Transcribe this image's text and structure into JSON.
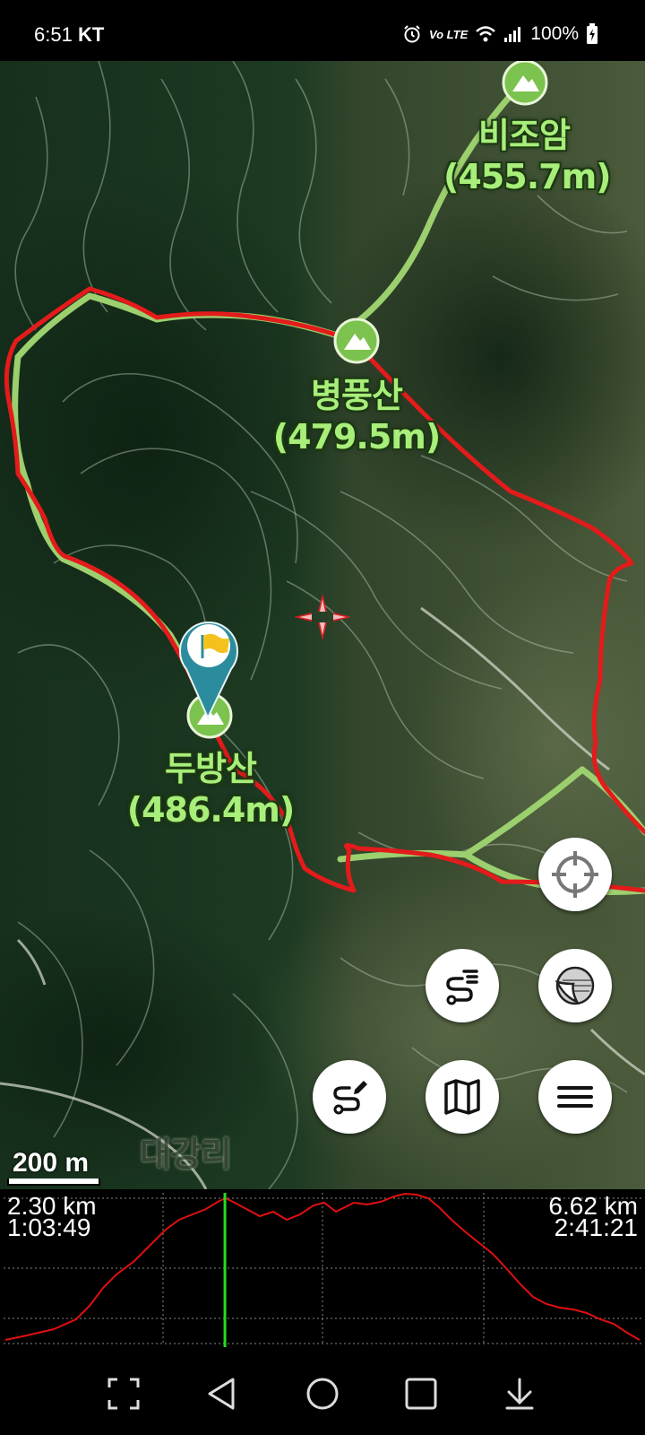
{
  "status_bar": {
    "time": "6:51",
    "carrier": "KT",
    "volte": "Vo LTE",
    "battery": "100%",
    "icons": [
      "alarm-icon",
      "volte-icon",
      "wifi-icon",
      "signal-icon",
      "battery-icon"
    ]
  },
  "map": {
    "peaks": [
      {
        "name": "비조암",
        "elevation": "(455.7m)"
      },
      {
        "name": "병풍산",
        "elevation": "(479.5m)"
      },
      {
        "name": "두방산",
        "elevation": "(486.4m)"
      }
    ],
    "place_label": "대강리",
    "scale_label": "200 m",
    "colors": {
      "track": "#e31b1b",
      "trail": "#9ccf6e",
      "marker": "#2a8c9c",
      "flag": "#f4c21f"
    }
  },
  "map_buttons": [
    {
      "id": "my-location",
      "icon": "crosshair-icon"
    },
    {
      "id": "track-list",
      "icon": "route-list-icon"
    },
    {
      "id": "map-layers",
      "icon": "page-curl-icon"
    },
    {
      "id": "draw-route",
      "icon": "route-edit-icon"
    },
    {
      "id": "maps",
      "icon": "map-icon"
    },
    {
      "id": "menu",
      "icon": "menu-icon"
    }
  ],
  "elevation_profile": {
    "current_distance": "2.30 km",
    "current_time": "1:03:49",
    "total_distance": "6.62 km",
    "total_time": "2:41:21",
    "cursor_fraction": 0.347,
    "colors": {
      "profile": "#e01010",
      "cursor": "#22dd22",
      "grid": "#888888"
    }
  },
  "nav_bar": [
    "fullscreen-icon",
    "back-icon",
    "home-icon",
    "recents-icon",
    "hide-bar-icon"
  ]
}
